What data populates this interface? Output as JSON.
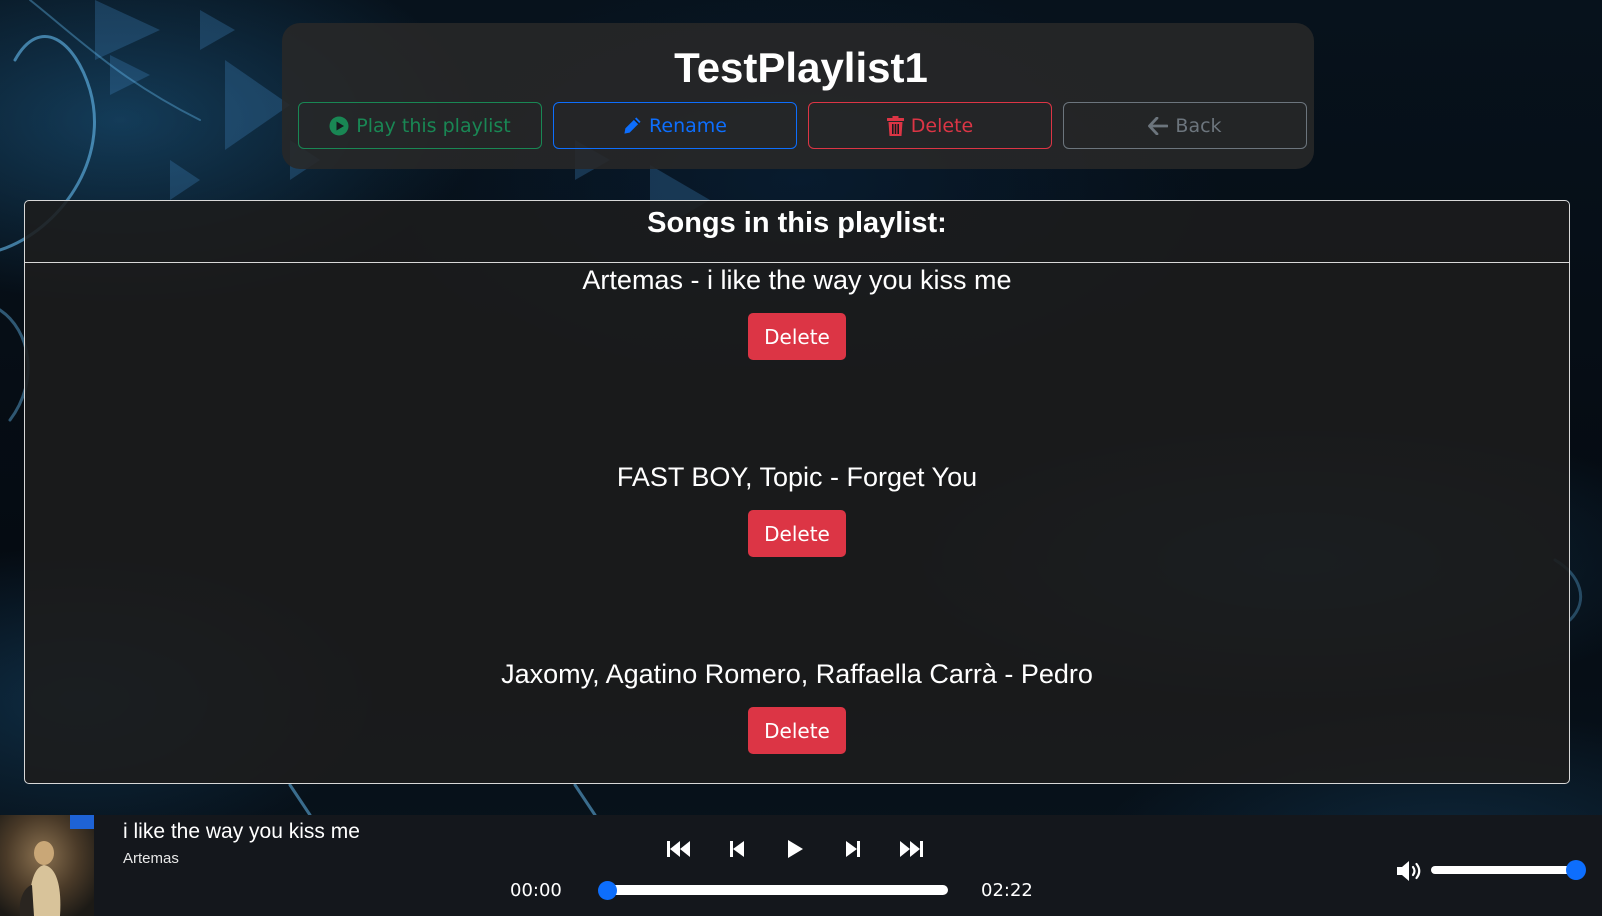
{
  "playlist": {
    "title": "TestPlaylist1",
    "actions": {
      "play_label": "Play this playlist",
      "rename_label": "Rename",
      "delete_label": "Delete",
      "back_label": "Back"
    }
  },
  "songs": {
    "heading": "Songs in this playlist:",
    "items": [
      {
        "name": "Artemas - i like the way you kiss me",
        "delete_label": "Delete"
      },
      {
        "name": "FAST BOY, Topic - Forget You",
        "delete_label": "Delete"
      },
      {
        "name": "Jaxomy, Agatino Romero, Raffaella Carrà - Pedro",
        "delete_label": "Delete"
      }
    ]
  },
  "player": {
    "track_title": "i like the way you kiss me",
    "track_artist": "Artemas",
    "time_current": "00:00",
    "time_total": "02:22",
    "progress_fraction": 0.0,
    "volume_fraction": 1.0,
    "controls": [
      "skip-to-start-icon",
      "previous-icon",
      "play-icon",
      "next-icon",
      "skip-to-end-icon"
    ]
  },
  "colors": {
    "success": "#198754",
    "primary": "#0d6efd",
    "danger": "#dc3545",
    "secondary": "#6c757d",
    "player_bg": "#14171c"
  }
}
